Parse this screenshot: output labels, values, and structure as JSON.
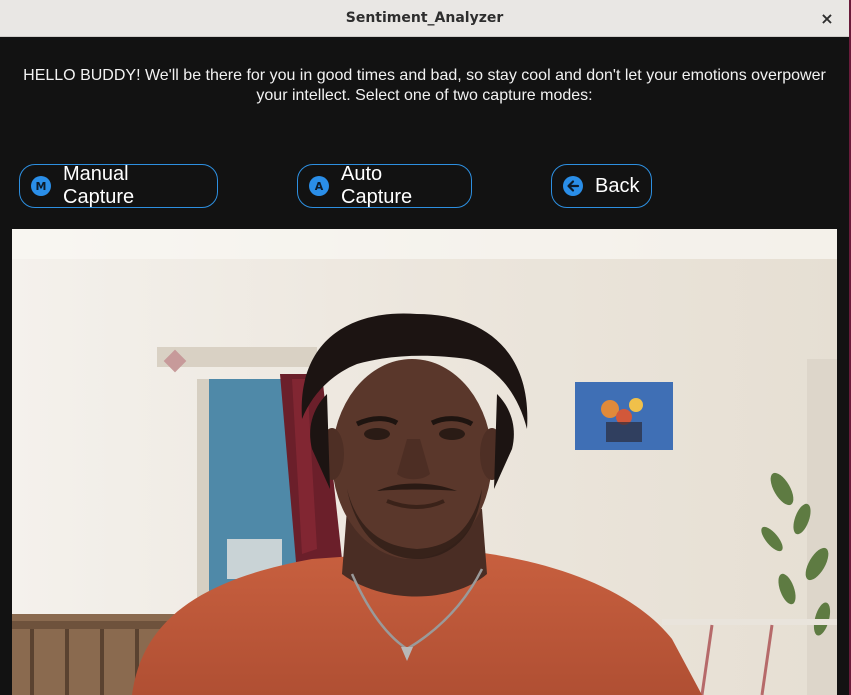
{
  "window": {
    "title": "Sentiment_Analyzer",
    "close_glyph": "×"
  },
  "message": "HELLO BUDDY! We'll be there for you in good times and bad, so stay cool and don't let your emotions overpower your intellect. Select one of two capture modes:",
  "buttons": {
    "manual": {
      "label": "Manual Capture",
      "icon": "m-circle-icon",
      "icon_glyph": "M"
    },
    "auto": {
      "label": "Auto Capture",
      "icon": "a-circle-icon",
      "icon_glyph": "A"
    },
    "back": {
      "label": "Back",
      "icon": "arrow-left-circle-icon",
      "icon_glyph": "←"
    }
  },
  "colors": {
    "window_bg": "#121212",
    "accent": "#2d8fe0",
    "titlebar_bg": "#e9e7e4"
  }
}
